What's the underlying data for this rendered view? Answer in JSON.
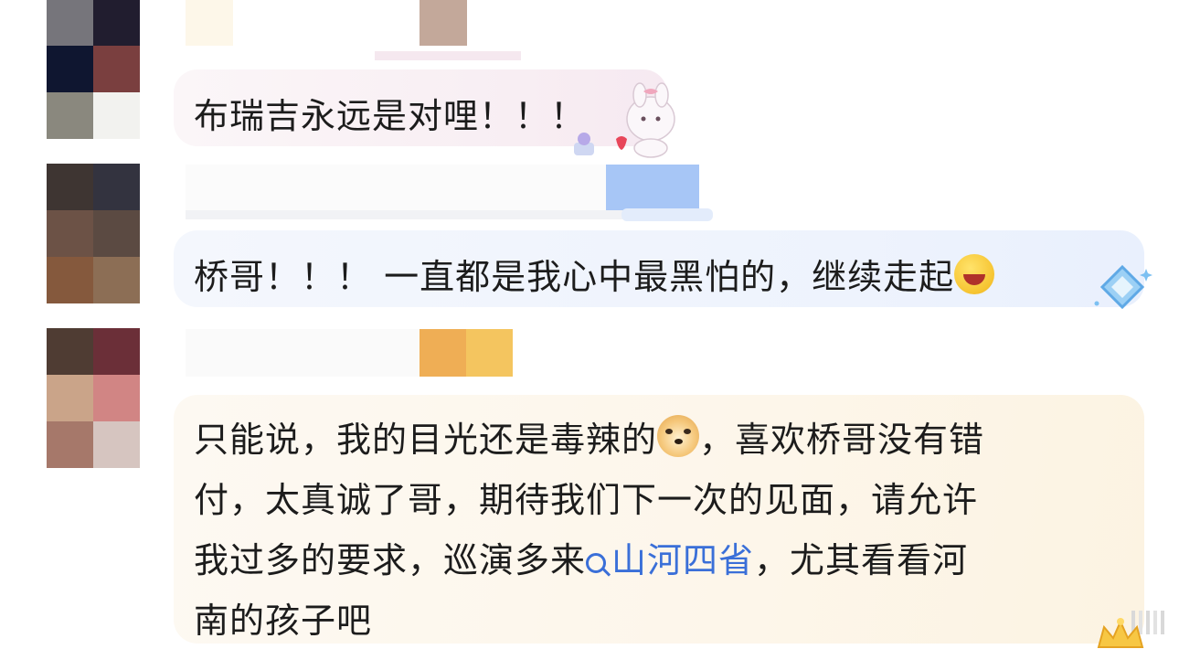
{
  "comments": [
    {
      "text": "布瑞吉永远是对哩！！！",
      "sticker": "bunny-strawberry-sticker"
    },
    {
      "text": "桥哥！！！ 一直都是我心中最黑怕的，继续走起",
      "emoji": "laugh-cheer-icon",
      "sticker": "diamond-sparkle-sticker"
    },
    {
      "lines": [
        "只能说，我的目光还是毒辣的",
        "，喜欢桥哥没有错",
        "付，太真诚了哥，期待我们下一次的见面，请允许",
        "我过多的要求，巡演多来",
        "山河四省",
        "，尤其看看河",
        "南的孩子吧"
      ],
      "emoji": "doge-icon",
      "topic_icon": "search-icon",
      "sticker": "sun-crown-sticker"
    }
  ],
  "colors": {
    "text": "#1c1c1c",
    "topic_link": "#3a6fd8",
    "bubble_pink": "#f8eef3",
    "bubble_blue": "#eef3fd",
    "bubble_cream": "#fdf6ea"
  }
}
